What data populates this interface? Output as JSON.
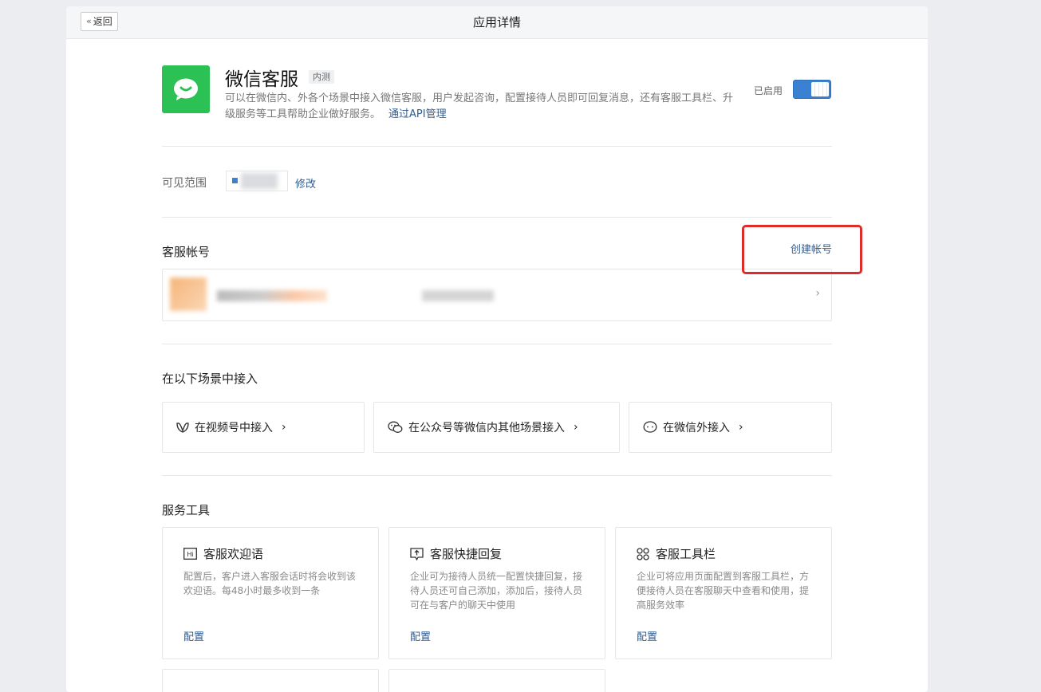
{
  "header": {
    "back_label": "返回",
    "title": "应用详情"
  },
  "app": {
    "name": "微信客服",
    "tag": "内测",
    "description": "可以在微信内、外各个场景中接入微信客服，用户发起咨询，配置接待人员即可回复消息，还有客服工具栏、升级服务等工具帮助企业做好服务。",
    "api_link": "通过API管理",
    "status_label": "已启用",
    "enabled": true,
    "brand_color": "#2bc155"
  },
  "visibility": {
    "label": "可见范围",
    "edit_link": "修改"
  },
  "accounts": {
    "title": "客服帐号",
    "create_link": "创建帐号"
  },
  "scenes": {
    "title": "在以下场景中接入",
    "items": [
      {
        "label": "在视频号中接入",
        "icon": "channels-icon"
      },
      {
        "label": "在公众号等微信内其他场景接入",
        "icon": "wechat-icon"
      },
      {
        "label": "在微信外接入",
        "icon": "chat-bubble-icon"
      }
    ]
  },
  "tools": {
    "title": "服务工具",
    "items": [
      {
        "title": "客服欢迎语",
        "desc": "配置后，客户进入客服会话时将会收到该欢迎语。每48小时最多收到一条",
        "action": "配置",
        "icon": "hi-icon"
      },
      {
        "title": "客服快捷回复",
        "desc": "企业可为接待人员统一配置快捷回复，接待人员还可自己添加，添加后，接待人员可在与客户的聊天中使用",
        "action": "配置",
        "icon": "quick-reply-icon"
      },
      {
        "title": "客服工具栏",
        "desc": "企业可将应用页面配置到客服工具栏，方便接待人员在客服聊天中查看和使用，提高服务效率",
        "action": "配置",
        "icon": "toolbar-grid-icon"
      }
    ]
  }
}
